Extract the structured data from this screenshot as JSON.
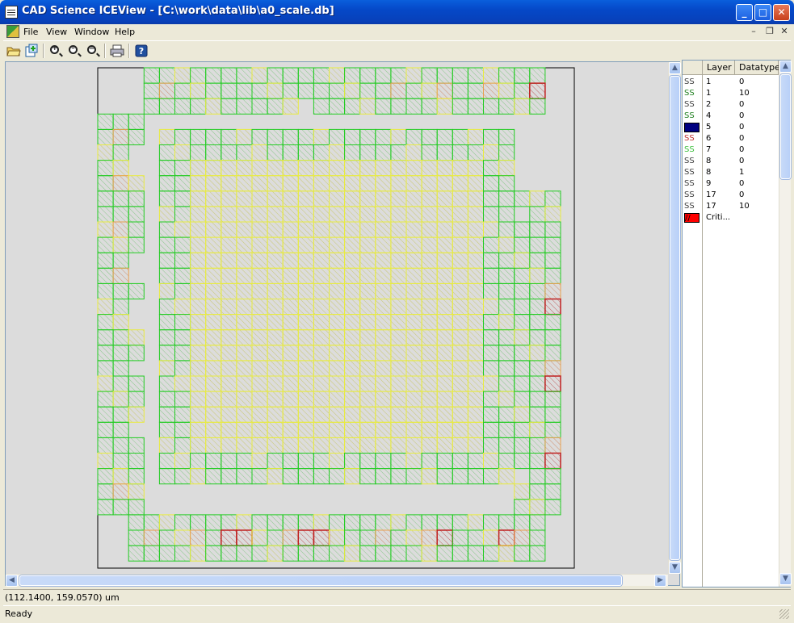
{
  "window": {
    "title": "CAD Science ICEView - [C:\\work\\data\\lib\\a0_scale.db]",
    "title_buttons": {
      "minimize": "_",
      "maximize": "□",
      "close": "✕"
    }
  },
  "menu": {
    "items": [
      "File",
      "View",
      "Window",
      "Help"
    ],
    "mdi_controls": {
      "minimize": "–",
      "restore": "❐",
      "close": "✕"
    }
  },
  "toolbar": {
    "icons": [
      "open-icon",
      "new-window-icon",
      "zoom-in-icon",
      "zoom-out-icon",
      "zoom-fit-icon",
      "print-icon",
      "help-icon"
    ]
  },
  "layer_list": {
    "headers": {
      "swatch": "",
      "layer": "Layer",
      "datatype": "Datatype"
    },
    "rows": [
      {
        "swatch_text": "SS",
        "swatch_color": "#404040",
        "layer": "1",
        "datatype": "0"
      },
      {
        "swatch_text": "SS",
        "swatch_color": "#208020",
        "layer": "1",
        "datatype": "10"
      },
      {
        "swatch_text": "SS",
        "swatch_color": "#404040",
        "layer": "2",
        "datatype": "0"
      },
      {
        "swatch_text": "SS",
        "swatch_color": "#208020",
        "layer": "4",
        "datatype": "0"
      },
      {
        "swatch_text": "",
        "swatch_color": "#000080",
        "layer": "5",
        "datatype": "0",
        "filled": true
      },
      {
        "swatch_text": "SS",
        "swatch_color": "#c03030",
        "layer": "6",
        "datatype": "0"
      },
      {
        "swatch_text": "SS",
        "swatch_color": "#40c040",
        "layer": "7",
        "datatype": "0"
      },
      {
        "swatch_text": "SS",
        "swatch_color": "#404040",
        "layer": "8",
        "datatype": "0"
      },
      {
        "swatch_text": "SS",
        "swatch_color": "#404040",
        "layer": "8",
        "datatype": "1"
      },
      {
        "swatch_text": "SS",
        "swatch_color": "#404040",
        "layer": "9",
        "datatype": "0"
      },
      {
        "swatch_text": "SS",
        "swatch_color": "#404040",
        "layer": "17",
        "datatype": "0"
      },
      {
        "swatch_text": "SS",
        "swatch_color": "#404040",
        "layer": "17",
        "datatype": "10"
      },
      {
        "swatch_text": "//",
        "swatch_color": "#ff0000",
        "layer": "Criti...",
        "datatype": "",
        "filled": true
      }
    ]
  },
  "status": {
    "coordinates": "(112.1400, 159.0570) um",
    "message": "Ready"
  },
  "colors": {
    "green": "#22cc22",
    "yellow": "#e8ec40",
    "orange": "#e8a050",
    "red": "#c02020",
    "canvas_bg": "#dcdcdc"
  }
}
